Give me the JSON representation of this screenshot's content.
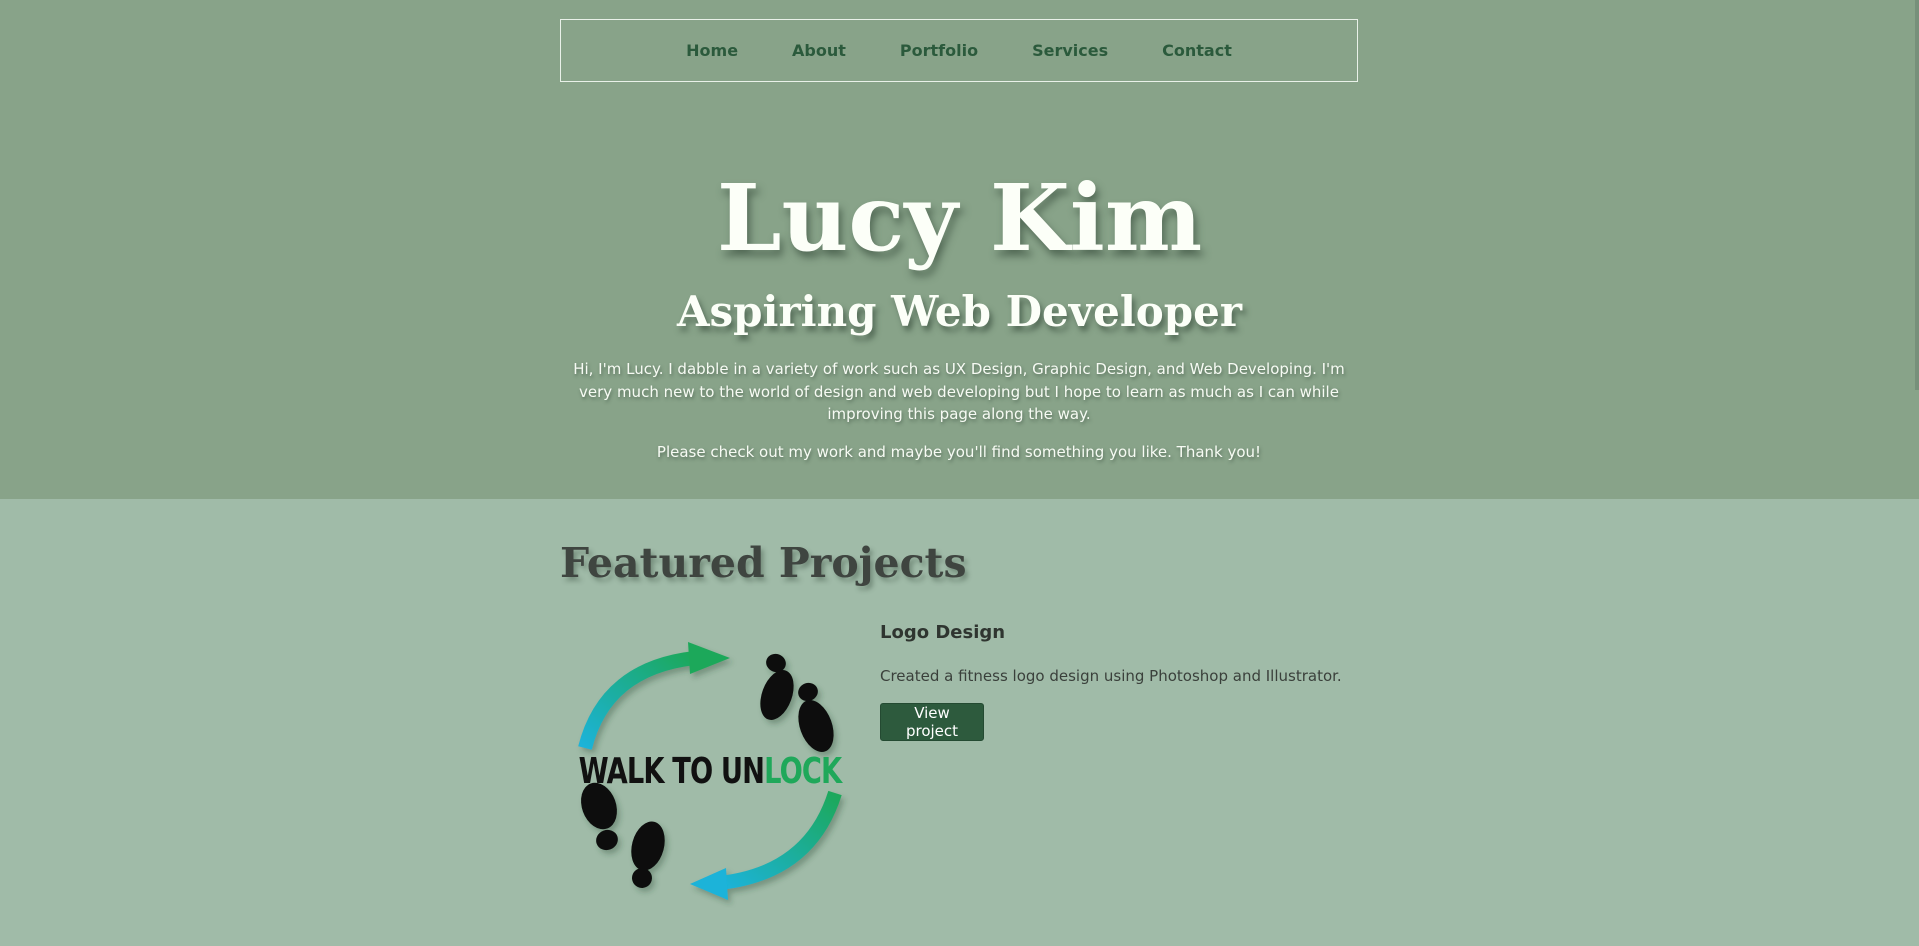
{
  "nav": {
    "items": [
      {
        "label": "Home"
      },
      {
        "label": "About"
      },
      {
        "label": "Portfolio"
      },
      {
        "label": "Services"
      },
      {
        "label": "Contact"
      }
    ]
  },
  "hero": {
    "name": "Lucy Kim",
    "role": "Aspiring Web Developer",
    "bio": "Hi, I'm Lucy. I dabble in a variety of work such as UX Design, Graphic Design, and Web Developing. I'm very much new to the world of design and web developing but I hope to learn as much as I can while improving this page along the way.",
    "thanks": "Please check out my work and maybe you'll find something you like. Thank you!"
  },
  "featured": {
    "title": "Featured Projects",
    "projects": [
      {
        "logo_text_dark": "WALK TO UN",
        "logo_text_green": "LOCK",
        "title": "Logo Design",
        "description": "Created a fitness logo design using Photoshop and Illustrator.",
        "button_label": "View project"
      }
    ]
  },
  "colors": {
    "hero_bg": "#88a389",
    "page_bg": "#a0bba8",
    "nav_text": "#2b5a3c",
    "button_bg": "#2d5a3d",
    "logo_green": "#1fa85a",
    "logo_blue": "#1ab3d9"
  }
}
